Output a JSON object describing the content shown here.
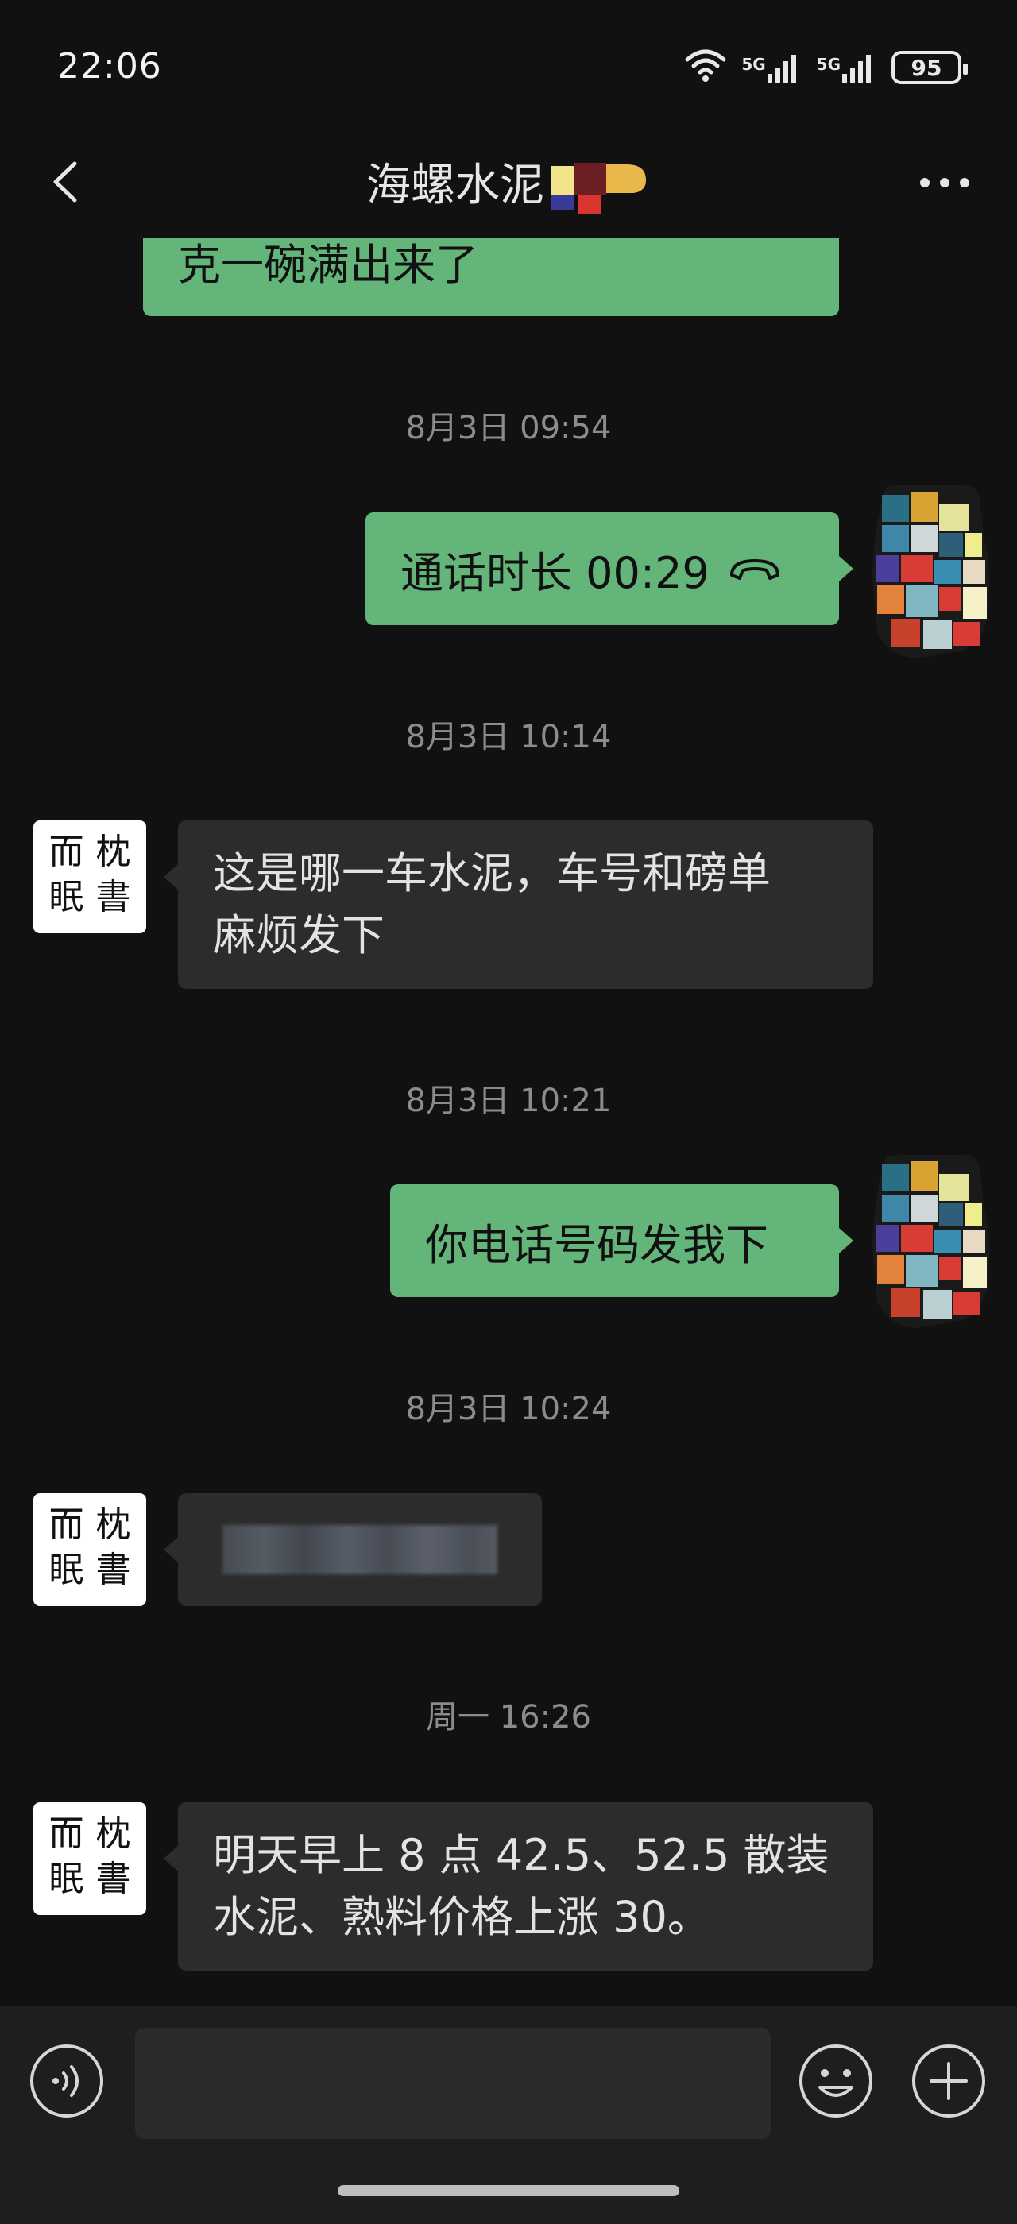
{
  "status_bar": {
    "time": "22:06",
    "signal1_label": "5G",
    "signal2_label": "5G",
    "battery": "95"
  },
  "header": {
    "title": "海螺水泥",
    "back_icon": "chevron-left-icon",
    "more_icon": "more-horizontal-icon"
  },
  "messages": [
    {
      "side": "right",
      "type": "text",
      "text": "克一碗满出来了"
    },
    {
      "type": "timestamp",
      "text": "8月3日 09:54"
    },
    {
      "side": "right",
      "type": "call",
      "text": "通话时长 00:29",
      "icon": "phone-hangup-icon"
    },
    {
      "type": "timestamp",
      "text": "8月3日 10:14"
    },
    {
      "side": "left",
      "type": "text",
      "text_line1": "这是哪一车水泥，车号和磅单",
      "text_line2": "麻烦发下"
    },
    {
      "type": "timestamp",
      "text": "8月3日 10:21"
    },
    {
      "side": "right",
      "type": "text",
      "text": "你电话号码发我下"
    },
    {
      "type": "timestamp",
      "text": "8月3日 10:24"
    },
    {
      "side": "left",
      "type": "redacted",
      "text": ""
    },
    {
      "type": "timestamp",
      "text": "周一 16:26"
    },
    {
      "side": "left",
      "type": "text",
      "text_line1": "明天早上 8 点 42.5、52.5 散装",
      "text_line2": "水泥、熟料价格上涨 30。"
    }
  ],
  "contact_avatar": {
    "chars": [
      "而",
      "枕",
      "眠",
      "書"
    ]
  },
  "input_bar": {
    "value": "",
    "voice_icon": "voice-icon",
    "emoji_icon": "emoji-smile-icon",
    "plus_icon": "plus-circle-icon"
  },
  "colors": {
    "background": "#111111",
    "bubble_sent": "#63b57a",
    "bubble_received": "#2c2c2c",
    "timestamp": "#8c8c8c"
  }
}
